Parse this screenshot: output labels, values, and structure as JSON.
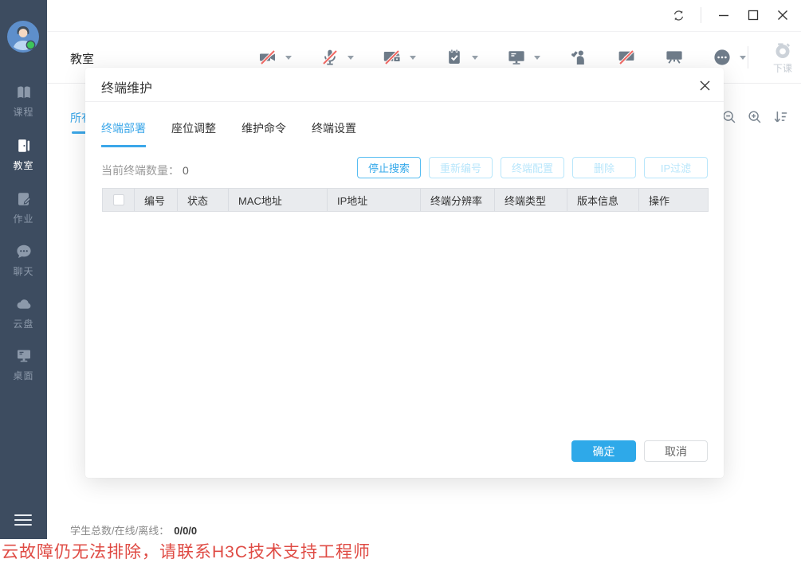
{
  "titlebar": {
    "controls": [
      "refresh",
      "minimize",
      "maximize",
      "close"
    ]
  },
  "sidebar": {
    "avatar": "user-avatar",
    "presence": "online",
    "items": [
      {
        "label": "课程",
        "icon": "book-icon",
        "active": false
      },
      {
        "label": "教室",
        "icon": "door-icon",
        "active": true
      },
      {
        "label": "作业",
        "icon": "homework-icon",
        "active": false
      },
      {
        "label": "聊天",
        "icon": "chat-icon",
        "active": false
      },
      {
        "label": "云盘",
        "icon": "cloud-icon",
        "active": false
      },
      {
        "label": "桌面",
        "icon": "desktop-icon",
        "active": false
      }
    ]
  },
  "header": {
    "title": "教室",
    "toolbar": [
      {
        "icon": "camera-icon",
        "muted": true,
        "caret": true
      },
      {
        "icon": "microphone-icon",
        "muted": true,
        "caret": true
      },
      {
        "icon": "screen-lock-icon",
        "muted": true,
        "caret": true
      },
      {
        "icon": "task-check-icon",
        "muted": false,
        "caret": true
      },
      {
        "icon": "screen-broadcast-icon",
        "muted": false,
        "caret": true
      },
      {
        "icon": "raise-hand-icon",
        "muted": false,
        "caret": false
      },
      {
        "icon": "discussion-icon",
        "muted": true,
        "caret": false
      },
      {
        "icon": "projection-screen-icon",
        "muted": false,
        "caret": false
      },
      {
        "icon": "more-icon",
        "muted": false,
        "caret": true
      }
    ],
    "dismiss_label": "下课"
  },
  "background_page": {
    "tab_label": "所有",
    "tools": [
      "zoom-out-icon",
      "zoom-in-icon",
      "sort-descending-icon"
    ]
  },
  "modal": {
    "title": "终端维护",
    "tabs": [
      {
        "label": "终端部署",
        "active": true
      },
      {
        "label": "座位调整",
        "active": false
      },
      {
        "label": "维护命令",
        "active": false
      },
      {
        "label": "终端设置",
        "active": false
      }
    ],
    "count_label": "当前终端数量：",
    "count_value": "0",
    "actions": [
      {
        "label": "停止搜索",
        "enabled": true
      },
      {
        "label": "重新编号",
        "enabled": false
      },
      {
        "label": "终端配置",
        "enabled": false
      },
      {
        "label": "删除",
        "enabled": false
      },
      {
        "label": "IP过滤",
        "enabled": false
      }
    ],
    "table": {
      "columns": [
        "编号",
        "状态",
        "MAC地址",
        "IP地址",
        "终端分辨率",
        "终端类型",
        "版本信息",
        "操作"
      ],
      "rows": []
    },
    "ok_label": "确定",
    "cancel_label": "取消"
  },
  "statusbar": {
    "label": "学生总数/在线/离线：",
    "value": "0/0/0"
  },
  "ticker": {
    "text": "云故障仍无法排除，请联系H3C技术支持工程师"
  },
  "colors": {
    "accent": "#2fa7e9",
    "sidebar": "#3d4c60",
    "icon_gray": "#6f7c8a",
    "mute_red": "#f26b66",
    "disabled_blue": "#b8e6fb",
    "danger_text": "#df4b44",
    "table_header_bg": "#e9ebee"
  }
}
